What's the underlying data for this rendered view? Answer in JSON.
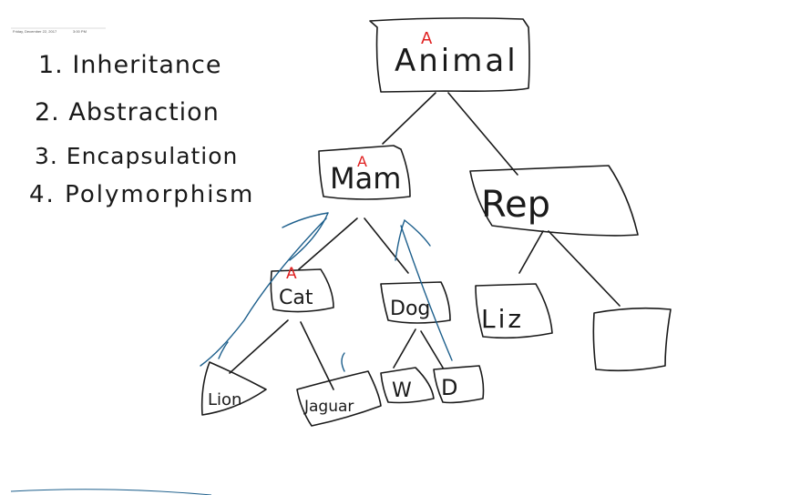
{
  "header": {
    "date": "Friday, December 22, 2017",
    "time": "3:00 PM"
  },
  "list_items": [
    "1. Inheritance",
    "2. Abstraction",
    "3. Encapsulation",
    "4. Polymorphism"
  ],
  "nodes": {
    "animal": "Animal",
    "mam": "Mam",
    "rep": "Rep",
    "cat": "Cat",
    "dog": "Dog",
    "liz": "Liz",
    "lion": "Lion",
    "jaguar": "Jaguar",
    "w": "W",
    "d": "D"
  },
  "abstract_marker": "A",
  "colors": {
    "ink": "#1a1a1a",
    "blue": "#1d5f8c",
    "red": "#e02020"
  }
}
